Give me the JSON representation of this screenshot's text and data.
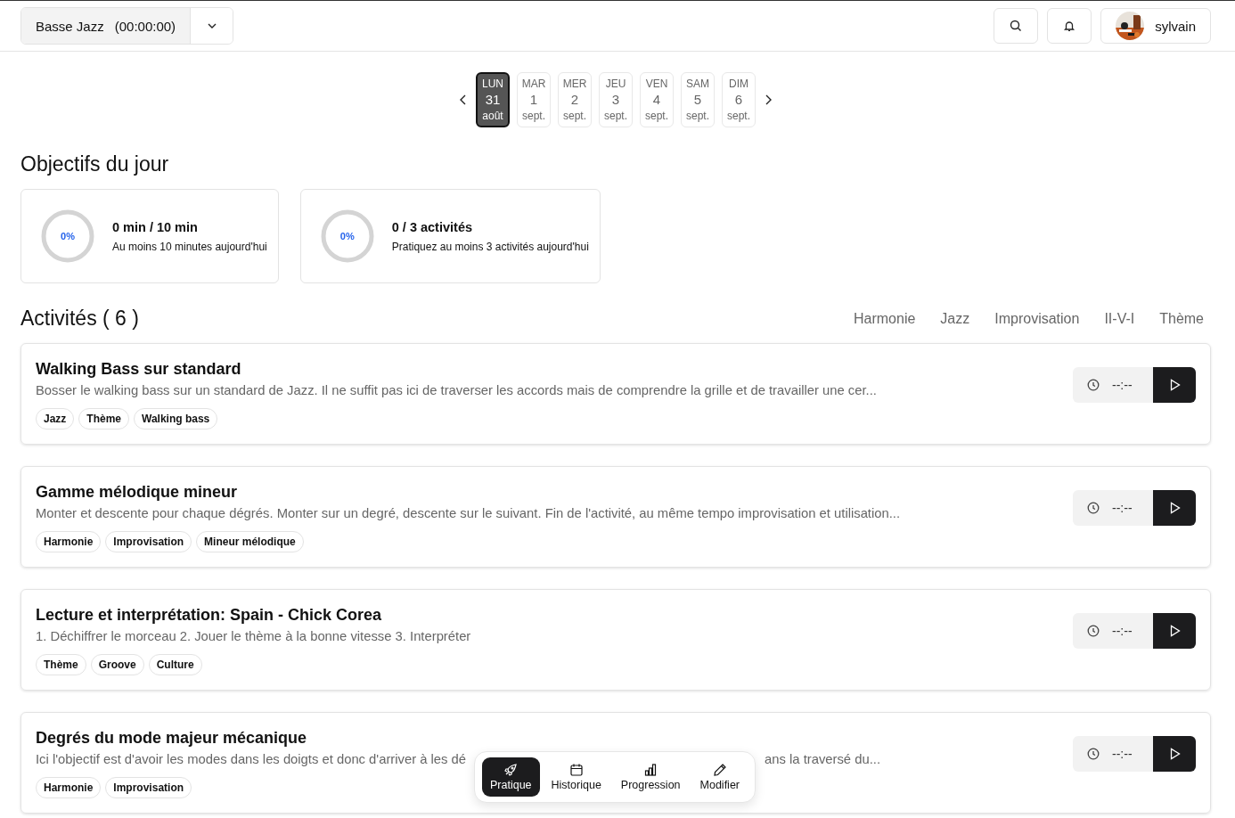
{
  "header": {
    "instrument": "Basse Jazz",
    "timer": "(00:00:00)",
    "user": "sylvain"
  },
  "days": [
    {
      "weekday": "LUN",
      "day": "31",
      "month": "août",
      "selected": true
    },
    {
      "weekday": "MAR",
      "day": "1",
      "month": "sept.",
      "selected": false
    },
    {
      "weekday": "MER",
      "day": "2",
      "month": "sept.",
      "selected": false
    },
    {
      "weekday": "JEU",
      "day": "3",
      "month": "sept.",
      "selected": false
    },
    {
      "weekday": "VEN",
      "day": "4",
      "month": "sept.",
      "selected": false
    },
    {
      "weekday": "SAM",
      "day": "5",
      "month": "sept.",
      "selected": false
    },
    {
      "weekday": "DIM",
      "day": "6",
      "month": "sept.",
      "selected": false
    }
  ],
  "goals_title": "Objectifs du jour",
  "goals": [
    {
      "percent": "0%",
      "level": 0,
      "title": "0 min / 10 min",
      "subtitle": "Au moins 10 minutes aujourd'hui"
    },
    {
      "percent": "0%",
      "level": 0,
      "title": "0 / 3 activités",
      "subtitle": "Pratiquez au moins 3 activités aujourd'hui"
    }
  ],
  "activities_title": "Activités ( 6 )",
  "filters": [
    {
      "label": "Harmonie",
      "selected": false
    },
    {
      "label": "Jazz",
      "selected": false
    },
    {
      "label": "Improvisation",
      "selected": false
    },
    {
      "label": "II-V-I",
      "selected": false
    },
    {
      "label": "Thème",
      "selected": false
    }
  ],
  "activities": [
    {
      "title": "Walking Bass sur standard",
      "description": [
        "Bosser le walking bass sur un standard de Jazz. Il ne suffit pas ici de traverser les accords mais de comprendre la grille et de travailler une cer..."
      ],
      "tags": [
        "Jazz",
        "Thème",
        "Walking bass"
      ],
      "time": "--:--"
    },
    {
      "title": "Gamme mélodique mineur",
      "description": [
        "Monter et descente pour chaque dégrés. Monter sur un degré, descente sur le suivant. Fin de l'activité, au même tempo improvisation et utilisation..."
      ],
      "tags": [
        "Harmonie",
        "Improvisation",
        "Mineur mélodique"
      ],
      "time": "--:--"
    },
    {
      "title": "Lecture et interprétation: Spain - Chick Corea",
      "description": [
        "1. Déchiffrer le morceau 2. Jouer le thème à la bonne vitesse 3. Interpréter"
      ],
      "tags": [
        "Thème",
        "Groove",
        "Culture"
      ],
      "time": "--:--"
    },
    {
      "title": "Degrés du mode majeur mécanique",
      "description": [
        "Ici l'objectif est d'avoir les modes dans les doigts et donc d'arriver à les dé",
        "ans la traversé du..."
      ],
      "tags": [
        "Harmonie",
        "Improvisation"
      ],
      "time": "--:--"
    }
  ],
  "bottom_nav": [
    {
      "label": "Pratique",
      "selected": true
    },
    {
      "label": "Historique",
      "selected": false
    },
    {
      "label": "Progression",
      "selected": false
    },
    {
      "label": "Modifier",
      "selected": false
    }
  ]
}
